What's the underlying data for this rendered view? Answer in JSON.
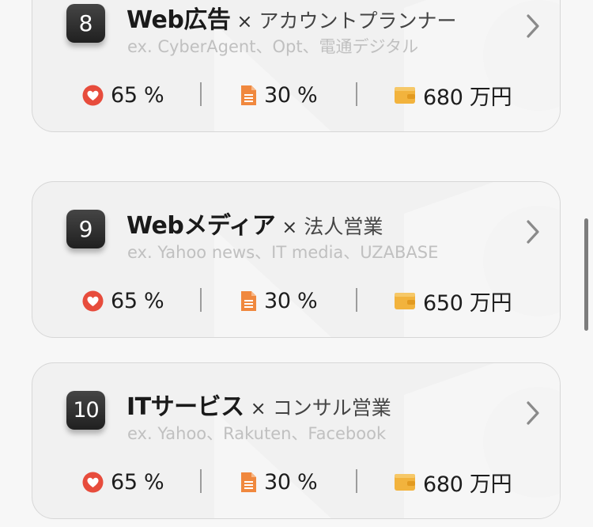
{
  "cards": [
    {
      "rank": "8",
      "title": "Web広告",
      "times": "×",
      "role": "アカウントプランナー",
      "examples": "ex. CyberAgent、Opt、電通デジタル",
      "stat_like": "65 %",
      "stat_doc": "30 %",
      "stat_salary": "680 万円"
    },
    {
      "rank": "9",
      "title": "Webメディア",
      "times": "×",
      "role": "法人営業",
      "examples": "ex. Yahoo news、IT media、UZABASE",
      "stat_like": "65 %",
      "stat_doc": "30 %",
      "stat_salary": "650 万円"
    },
    {
      "rank": "10",
      "title": "ITサービス",
      "times": "×",
      "role": "コンサル営業",
      "examples": "ex. Yahoo、Rakuten、Facebook",
      "stat_like": "65 %",
      "stat_doc": "30 %",
      "stat_salary": "680 万円"
    }
  ],
  "icons": {
    "like": "heart-icon",
    "doc": "document-icon",
    "salary": "wallet-icon",
    "open": "chevron-right-icon"
  },
  "colors": {
    "heart": "#e74c3c",
    "doc": "#f0883e",
    "wallet": "#f2b33d",
    "rank_badge": "#2e2e2e"
  }
}
